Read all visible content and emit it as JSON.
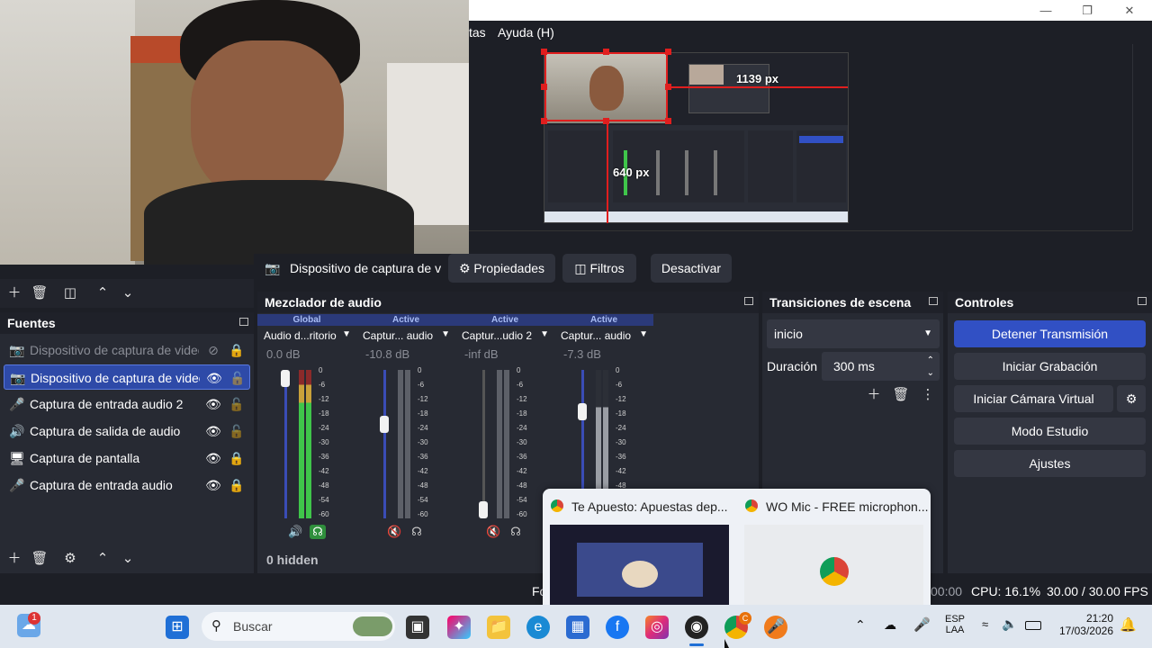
{
  "menu": {
    "item_partial": "tas",
    "help": "Ayuda (H)"
  },
  "preview": {
    "width_readout": "1139 px",
    "height_readout": "640 px"
  },
  "source_toolbar": {
    "source_name": "Dispositivo de captura de v",
    "properties": "Propiedades",
    "filters": "Filtros",
    "deactivate": "Desactivar"
  },
  "sources": {
    "title": "Fuentes",
    "items": [
      {
        "label": "Dispositivo de captura de video",
        "icon": "camera-icon",
        "visible": false,
        "locked": true
      },
      {
        "label": "Dispositivo de captura de video",
        "icon": "camera-icon",
        "visible": true,
        "locked": false,
        "selected": true
      },
      {
        "label": "Captura de entrada audio 2",
        "icon": "microphone-icon",
        "visible": true,
        "locked": false
      },
      {
        "label": "Captura de salida de audio",
        "icon": "speaker-icon",
        "visible": true,
        "locked": false
      },
      {
        "label": "Captura de pantalla",
        "icon": "monitor-icon",
        "visible": true,
        "locked": true
      },
      {
        "label": "Captura de entrada audio",
        "icon": "microphone-icon",
        "visible": true,
        "locked": true
      }
    ]
  },
  "mixer": {
    "title": "Mezclador de audio",
    "hidden_count": "0 hidden",
    "scale": [
      "0",
      "-6",
      "-12",
      "-18",
      "-24",
      "-30",
      "-36",
      "-42",
      "-48",
      "-54",
      "-60"
    ],
    "channels": [
      {
        "tag": "Global",
        "name": "Audio d...ritorio",
        "db": "0.0 dB",
        "level": 1.0,
        "muted": false
      },
      {
        "tag": "Active",
        "name": "Captur... audio",
        "db": "-10.8 dB",
        "level": 0.65,
        "muted": true
      },
      {
        "tag": "Active",
        "name": "Captur...udio 2",
        "db": "-inf dB",
        "level": 0.0,
        "muted": true
      },
      {
        "tag": "Active",
        "name": "Captur... audio",
        "db": "-7.3 dB",
        "level": 0.75,
        "muted": false
      }
    ]
  },
  "transitions": {
    "title": "Transiciones de escena",
    "selected": "inicio",
    "duration_label": "Duración",
    "duration_value": "300 ms"
  },
  "controls": {
    "title": "Controles",
    "stop_stream": "Detener Transmisión",
    "start_recording": "Iniciar Grabación",
    "virtual_cam": "Iniciar Cámara Virtual",
    "studio_mode": "Modo Estudio",
    "settings": "Ajustes"
  },
  "status": {
    "left_partial": "Fo",
    "time_partial": "00:00",
    "cpu": "CPU: 16.1%",
    "fps": "30.00 / 30.00 FPS"
  },
  "chrome_popup": {
    "tab1": "Te Apuesto: Apuestas dep...",
    "tab2": "WO Mic - FREE microphon..."
  },
  "taskbar": {
    "search_placeholder": "Buscar",
    "weather_badge": "1",
    "lang": "ESP",
    "layout": "LAA",
    "time": "21:20",
    "date": "17/03/2026",
    "chrome_badge": "C"
  },
  "colors": {
    "accent": "#3150c4",
    "panel": "#272a33",
    "selection_red": "#e01e1e"
  }
}
